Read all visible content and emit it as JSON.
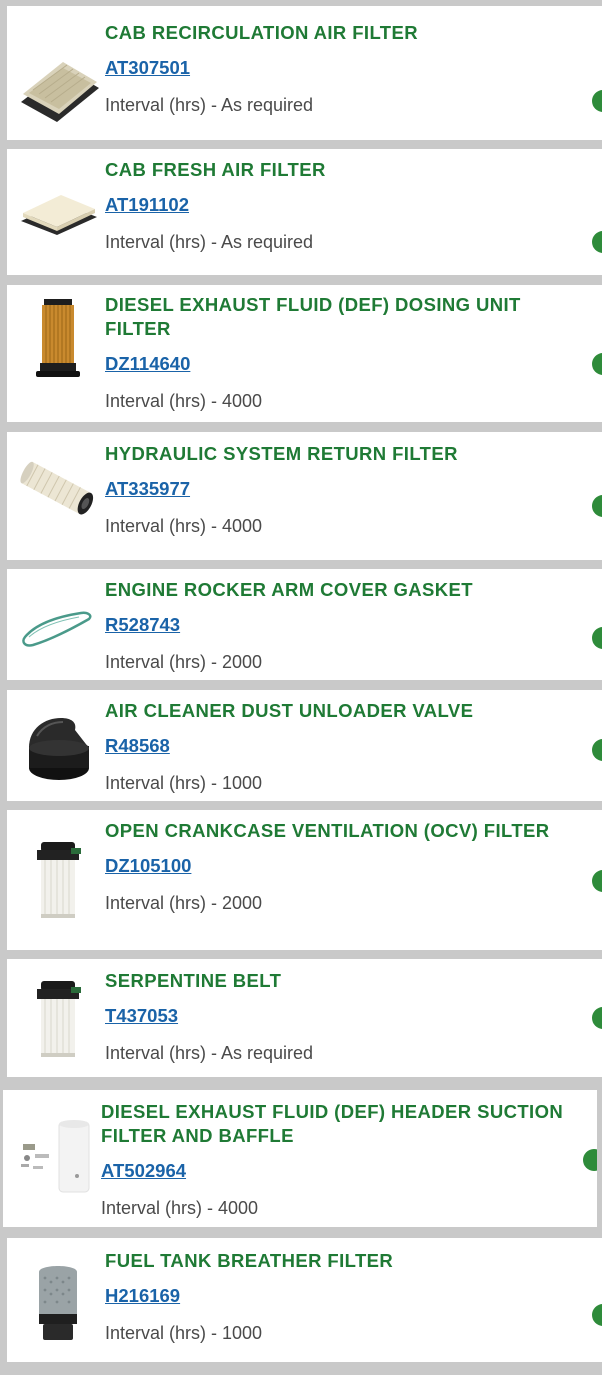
{
  "items": [
    {
      "title": "CAB RECIRCULATION AIR FILTER",
      "part": "AT307501",
      "interval": "Interval (hrs) - As required",
      "image_icon": "panel-filter-icon"
    },
    {
      "title": "CAB FRESH AIR FILTER",
      "part": "AT191102",
      "interval": "Interval (hrs) - As required",
      "image_icon": "panel-filter-icon"
    },
    {
      "title": "DIESEL EXHAUST FLUID (DEF) DOSING UNIT FILTER",
      "part": "DZ114640",
      "interval": "Interval (hrs) - 4000",
      "image_icon": "cartridge-filter-icon"
    },
    {
      "title": "HYDRAULIC SYSTEM RETURN FILTER",
      "part": "AT335977",
      "interval": "Interval (hrs) - 4000",
      "image_icon": "cylinder-filter-icon"
    },
    {
      "title": "ENGINE ROCKER ARM COVER GASKET",
      "part": "R528743",
      "interval": "Interval (hrs) - 2000",
      "image_icon": "gasket-icon"
    },
    {
      "title": "AIR CLEANER DUST UNLOADER VALVE",
      "part": "R48568",
      "interval": "Interval (hrs) - 1000",
      "image_icon": "rubber-valve-icon"
    },
    {
      "title": "OPEN CRANKCASE VENTILATION (OCV) FILTER",
      "part": "DZ105100",
      "interval": "Interval (hrs) - 2000",
      "image_icon": "ocv-filter-icon"
    },
    {
      "title": "SERPENTINE BELT",
      "part": "T437053",
      "interval": "Interval (hrs) - As required",
      "image_icon": "ocv-filter-icon"
    },
    {
      "title": "DIESEL EXHAUST FLUID (DEF) HEADER SUCTION FILTER AND BAFFLE",
      "part": "AT502964",
      "interval": "Interval (hrs) - 4000",
      "image_icon": "baffle-kit-icon"
    },
    {
      "title": "FUEL TANK BREATHER FILTER",
      "part": "H216169",
      "interval": "Interval (hrs) - 1000",
      "image_icon": "breather-filter-icon"
    }
  ],
  "colors": {
    "title": "#1f7a35",
    "part_link": "#1a63a8",
    "interval_text": "#4a4a4a",
    "page_background": "#c9c9c9",
    "card_background": "#ffffff",
    "status_dot": "#2e8b3a"
  }
}
